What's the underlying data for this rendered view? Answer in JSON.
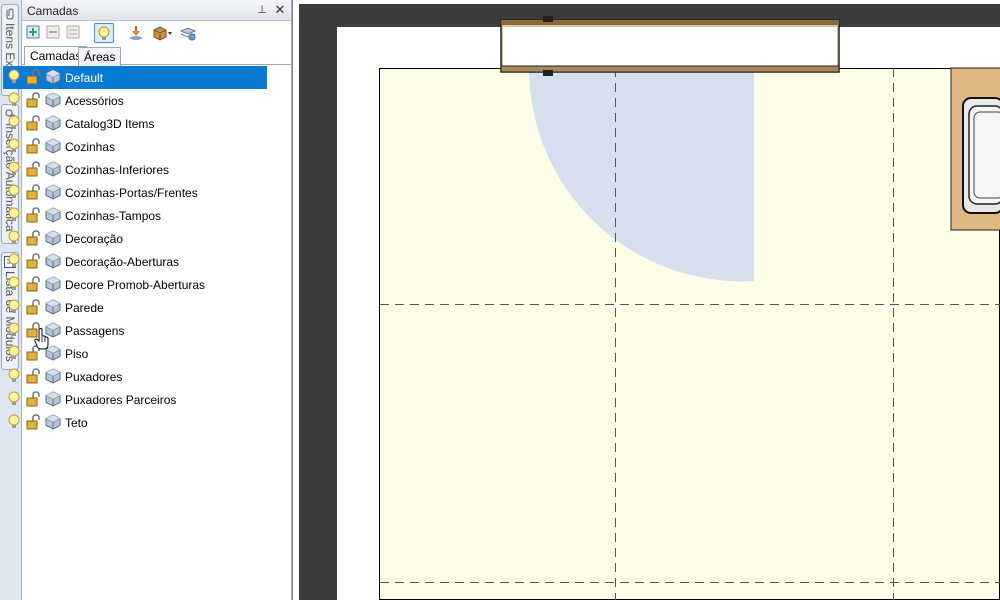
{
  "dock_tabs": [
    {
      "label": "Itens Extras",
      "icon": "paperclip-icon"
    },
    {
      "label": "Inserção Automática",
      "icon": "gears-icon"
    },
    {
      "label": "Lista de Módulos",
      "icon": "list-icon"
    }
  ],
  "panel": {
    "title": "Camadas",
    "pin_symbol": "⊥",
    "close_symbol": "✕"
  },
  "toolbar": {
    "buttons": [
      {
        "name": "add-layer-icon",
        "active": false
      },
      {
        "name": "remove-layer-icon",
        "active": false
      },
      {
        "name": "properties-icon",
        "active": false
      },
      {
        "name": "lightbulb-icon",
        "active": true
      },
      {
        "name": "drop-down-arrow-icon",
        "active": false
      },
      {
        "name": "box-dropdown-icon",
        "active": false
      },
      {
        "name": "layers-settings-icon",
        "active": false
      }
    ]
  },
  "tabs": [
    {
      "label": "Camadas",
      "selected": true
    },
    {
      "label": "Áreas",
      "selected": false
    }
  ],
  "layers": [
    "Default",
    "Acessórios",
    "Catalog3D Items",
    "Cozinhas",
    "Cozinhas-Inferiores",
    "Cozinhas-Portas/Frentes",
    "Cozinhas-Tampos",
    "Decoração",
    "Decoração-Aberturas",
    "Decore Promob-Aberturas",
    "Parede",
    "Passagens",
    "Piso",
    "Puxadores",
    "Puxadores Parceiros",
    "Teto"
  ],
  "selected_layer_index": 0,
  "colors": {
    "selection": "#0a7bd4",
    "floor": "#fefde8",
    "door_swing": "#d6dfee",
    "counter_wood": "#e0b883",
    "canvas_background": "#3c3c3c"
  }
}
